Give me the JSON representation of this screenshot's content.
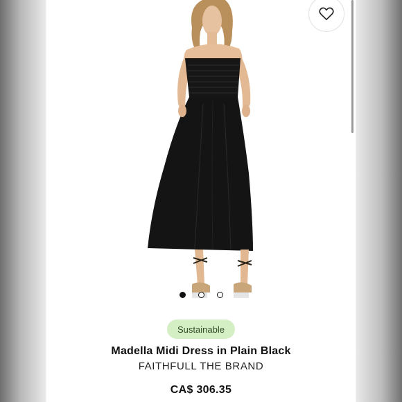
{
  "carousel": {
    "slide_count": 3,
    "active_slide": 1
  },
  "icons": {
    "wishlist": "heart-icon"
  },
  "product": {
    "badge": "Sustainable",
    "name": "Madella Midi Dress in Plain Black",
    "brand": "FAITHFULL THE BRAND",
    "price": "CA$ 306.35"
  },
  "colors": {
    "badge_bg": "#d5efc5",
    "dress": "#141414",
    "text": "#111111"
  }
}
